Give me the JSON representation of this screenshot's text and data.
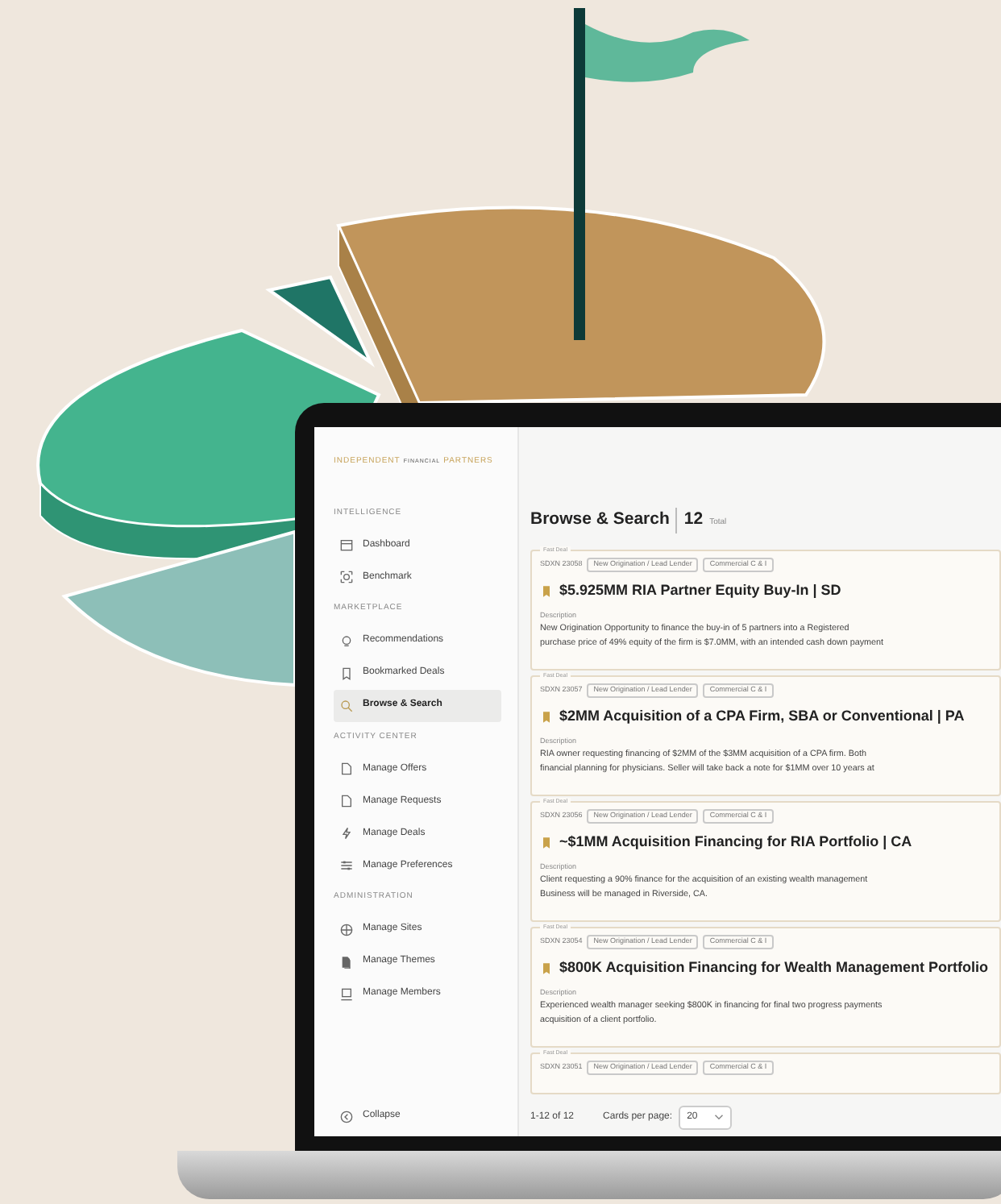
{
  "logo": {
    "parts": [
      "INDEPENDENT",
      "FINANCIAL",
      "PARTNERS"
    ]
  },
  "sidebar": {
    "sections": [
      {
        "heading": "INTELLIGENCE",
        "items": [
          {
            "label": "Dashboard",
            "selected": false
          },
          {
            "label": "Benchmark",
            "selected": false
          }
        ]
      },
      {
        "heading": "MARKETPLACE",
        "items": [
          {
            "label": "Recommendations",
            "selected": false
          },
          {
            "label": "Bookmarked Deals",
            "selected": false
          },
          {
            "label": "Browse & Search",
            "selected": true
          }
        ]
      },
      {
        "heading": "ACTIVITY CENTER",
        "items": [
          {
            "label": "Manage Offers",
            "selected": false
          },
          {
            "label": "Manage Requests",
            "selected": false
          },
          {
            "label": "Manage Deals",
            "selected": false
          },
          {
            "label": "Manage Preferences",
            "selected": false
          }
        ]
      },
      {
        "heading": "ADMINISTRATION",
        "items": [
          {
            "label": "Manage Sites",
            "selected": false
          },
          {
            "label": "Manage Themes",
            "selected": false
          },
          {
            "label": "Manage Members",
            "selected": false
          }
        ]
      }
    ],
    "collapse": "Collapse"
  },
  "page": {
    "title": "Browse & Search",
    "count": "12",
    "count_label": "Total"
  },
  "cards": [
    {
      "badge": "Fast Deal",
      "id": "SDXN 23058",
      "tags": [
        "New Origination / Lead Lender",
        "Commercial C & I"
      ],
      "title": "$5.925MM RIA Partner Equity Buy-In | SD",
      "description_label": "Description",
      "description": [
        "New Origination Opportunity to finance the buy-in of 5 partners into a Registered",
        "purchase price of 49% equity of the firm is $7.0MM, with an intended cash down payment"
      ]
    },
    {
      "badge": "Fast Deal",
      "id": "SDXN 23057",
      "tags": [
        "New Origination / Lead Lender",
        "Commercial C & I"
      ],
      "title": "$2MM Acquisition of a CPA Firm, SBA or Conventional | PA",
      "description_label": "Description",
      "description": [
        "RIA owner requesting financing of $2MM of the $3MM acquisition of a CPA firm. Both",
        "financial planning for physicians. Seller will take back a note for $1MM over 10 years at"
      ]
    },
    {
      "badge": "Fast Deal",
      "id": "SDXN 23056",
      "tags": [
        "New Origination / Lead Lender",
        "Commercial C & I"
      ],
      "title": "~$1MM Acquisition Financing for RIA Portfolio | CA",
      "description_label": "Description",
      "description": [
        "Client requesting a 90% finance for the acquisition of an existing wealth management",
        "Business will be managed in Riverside, CA."
      ]
    },
    {
      "badge": "Fast Deal",
      "id": "SDXN 23054",
      "tags": [
        "New Origination / Lead Lender",
        "Commercial C & I"
      ],
      "title": "$800K Acquisition Financing for Wealth Management Portfolio",
      "description_label": "Description",
      "description": [
        "Experienced wealth manager seeking $800K in financing for final two progress payments",
        "acquisition of a client portfolio."
      ]
    },
    {
      "badge": "Fast Deal",
      "id": "SDXN 23051",
      "tags": [
        "New Origination / Lead Lender",
        "Commercial C & I"
      ]
    }
  ],
  "pagination": {
    "range": "1-12 of 12",
    "per_page_label": "Cards per page:",
    "per_page": "20"
  }
}
